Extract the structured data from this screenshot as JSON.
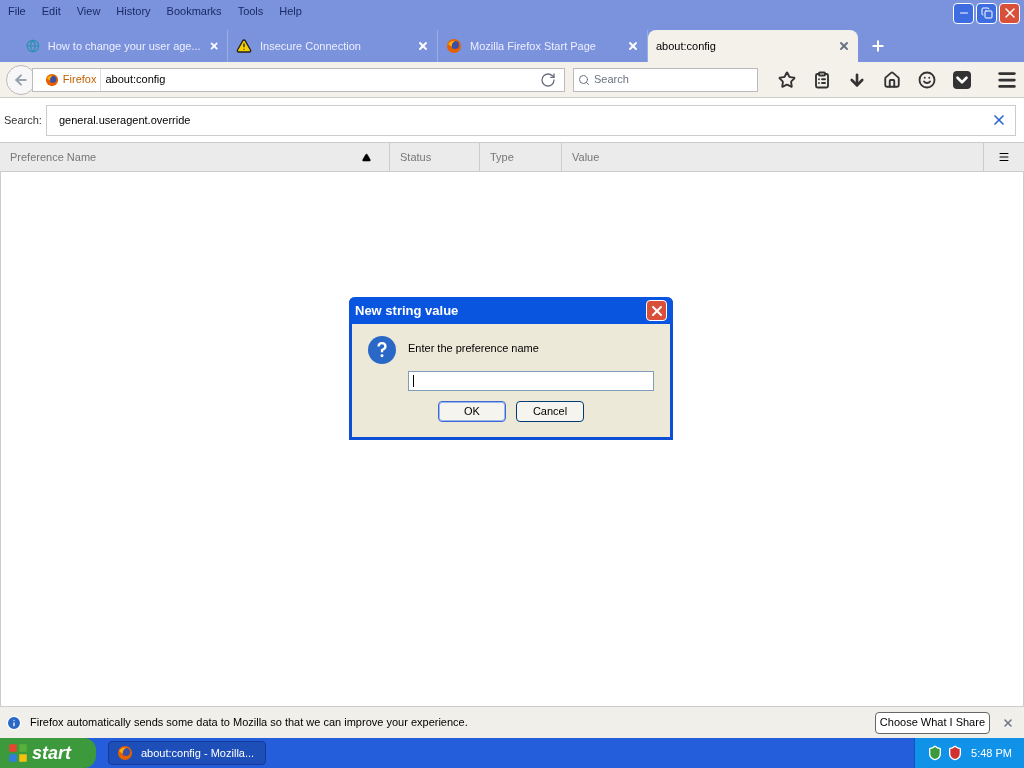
{
  "menu": [
    "File",
    "Edit",
    "View",
    "History",
    "Bookmarks",
    "Tools",
    "Help"
  ],
  "tabs": [
    {
      "title": "How to change your user age...",
      "selected": false
    },
    {
      "title": "Insecure Connection",
      "selected": false
    },
    {
      "title": "Mozilla Firefox Start Page",
      "selected": false
    },
    {
      "title": "about:config",
      "selected": true
    }
  ],
  "urlbar": {
    "identity": "Firefox",
    "url": "about:config"
  },
  "searchbar": {
    "placeholder": "Search"
  },
  "filter": {
    "label": "Search:",
    "value": "general.useragent.override"
  },
  "columns": [
    {
      "label": "Preference Name",
      "sorted": true
    },
    {
      "label": "Status",
      "sorted": false
    },
    {
      "label": "Type",
      "sorted": false
    },
    {
      "label": "Value",
      "sorted": false
    }
  ],
  "dialog": {
    "title": "New string value",
    "prompt": "Enter the preference name",
    "buttons": [
      {
        "label": "OK",
        "default": true
      },
      {
        "label": "Cancel",
        "default": false
      }
    ]
  },
  "notification": {
    "text": "Firefox automatically sends some data to Mozilla so that we can improve your experience.",
    "button": "Choose What I Share"
  },
  "taskbar": {
    "start": "start",
    "tasks": [
      {
        "title": "about:config - Mozilla...",
        "selected": true
      }
    ],
    "clock": "5:48 PM"
  }
}
